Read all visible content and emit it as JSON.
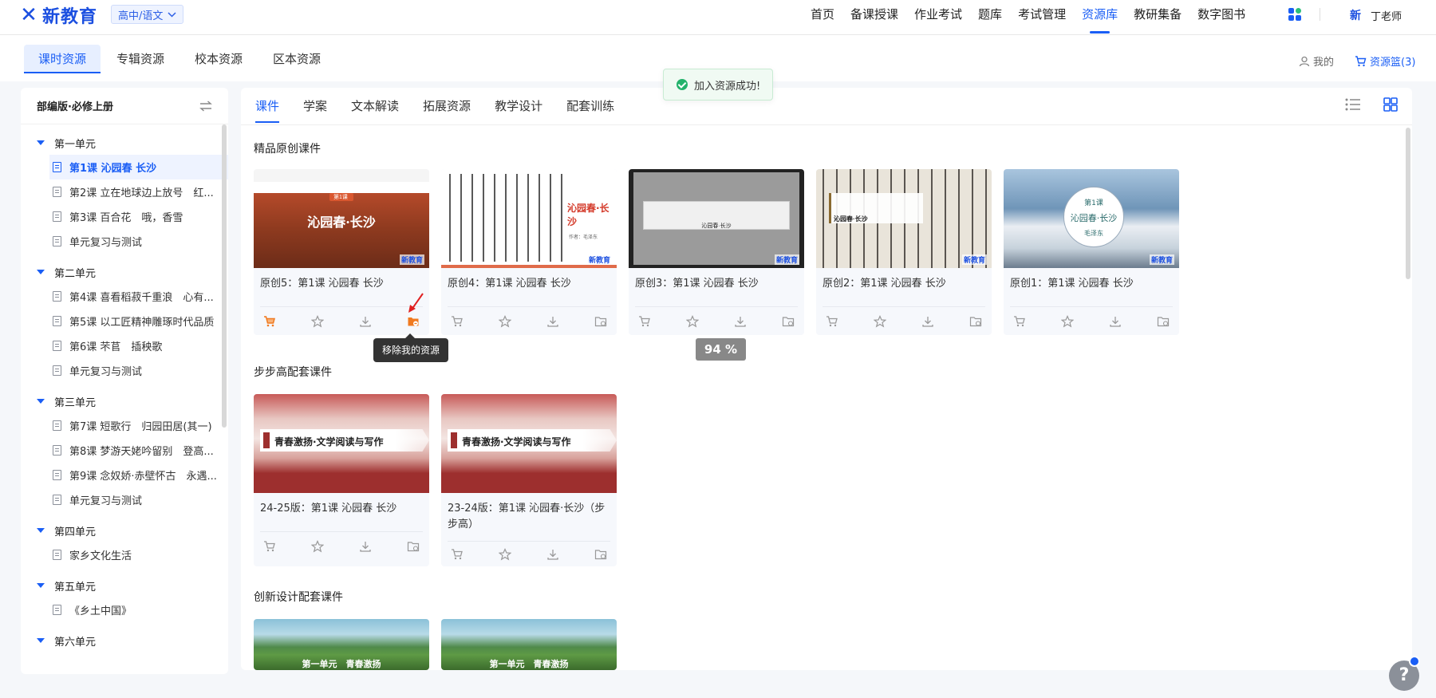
{
  "logo": {
    "text": "新教育",
    "mark": "✕"
  },
  "stage_select": {
    "label": "高中/语文"
  },
  "nav": {
    "items": [
      "首页",
      "备课授课",
      "作业考试",
      "题库",
      "考试管理",
      "资源库",
      "教研集备",
      "数字图书"
    ],
    "active_index": 5
  },
  "user": {
    "avatar_text": "新",
    "name": "丁老师"
  },
  "subtabs": [
    "课时资源",
    "专辑资源",
    "校本资源",
    "区本资源"
  ],
  "mine_label": "我的",
  "basket_label": "资源篮(3)",
  "sidebar": {
    "title": "部编版·必修上册",
    "units": [
      {
        "name": "第一单元",
        "lessons": [
          "第1课 沁园春 长沙",
          "第2课 立在地球边上放号　红...",
          "第3课 百合花　哦，香雪",
          "单元复习与测试"
        ]
      },
      {
        "name": "第二单元",
        "lessons": [
          "第4课 喜看稻菽千重浪　心有...",
          "第5课 以工匠精神雕琢时代品质",
          "第6课 芣苢　插秧歌",
          "单元复习与测试"
        ]
      },
      {
        "name": "第三单元",
        "lessons": [
          "第7课 短歌行　归园田居(其一)",
          "第8课 梦游天姥吟留别　登高...",
          "第9课 念奴娇·赤壁怀古　永遇...",
          "单元复习与测试"
        ]
      },
      {
        "name": "第四单元",
        "lessons": [
          "家乡文化生活"
        ]
      },
      {
        "name": "第五单元",
        "lessons": [
          "《乡土中国》"
        ]
      },
      {
        "name": "第六单元",
        "lessons": []
      }
    ]
  },
  "content_tabs": [
    "课件",
    "学案",
    "文本解读",
    "拓展资源",
    "教学设计",
    "配套训练"
  ],
  "sections": [
    {
      "title": "精品原创课件",
      "cards": [
        {
          "title": "原创5：第1课 沁园春 长沙",
          "thumb_text": "沁园春·长沙"
        },
        {
          "title": "原创4：第1课 沁园春 长沙",
          "thumb_text": "沁园春·长沙"
        },
        {
          "title": "原创3：第1课 沁园春 长沙",
          "thumb_text": "沁园春·长沙"
        },
        {
          "title": "原创2：第1课 沁园春 长沙",
          "thumb_text": "沁园春·长沙"
        },
        {
          "title": "原创1：第1课 沁园春 长沙",
          "thumb_text": "沁园春·长沙"
        }
      ]
    },
    {
      "title": "步步高配套课件",
      "cards": [
        {
          "title": "24-25版：第1课 沁园春 长沙",
          "thumb_text": "青春激扬·文学阅读与写作"
        },
        {
          "title": "23-24版：第1课 沁园春·长沙（步步高）",
          "thumb_text": "青春激扬·文学阅读与写作"
        }
      ]
    },
    {
      "title": "创新设计配套课件",
      "cards": [
        {
          "thumb_text": "第一单元　青春激扬"
        },
        {
          "thumb_text": "第一单元　青春激扬"
        }
      ]
    }
  ],
  "thumb_extras": {
    "card1_badge": "第1课",
    "card2_author": "作者：毛泽东",
    "card5_lesson": "第1课",
    "card5_author": "毛泽东",
    "brand": "新教育"
  },
  "toast": "加入资源成功!",
  "tooltip": "移除我的资源",
  "progress": "94 %",
  "help": "?",
  "colors": {
    "accent": "#1a5ef5",
    "success": "#23b26b",
    "active_icon": "#f07a20"
  }
}
